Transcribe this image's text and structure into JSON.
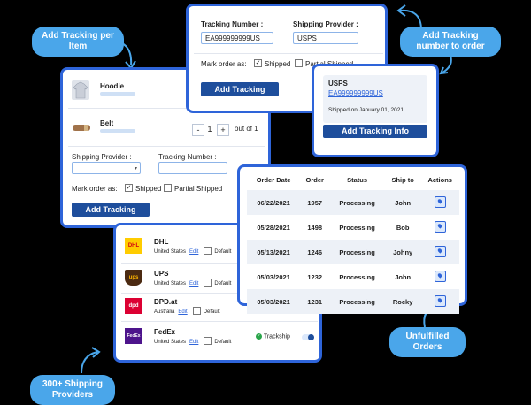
{
  "callouts": {
    "per_item": "Add Tracking per Item",
    "to_order": "Add Tracking number to order",
    "unfulfilled": "Unfulfilled Orders",
    "providers": "300+ Shipping Providers"
  },
  "top_panel": {
    "tracking_label": "Tracking Number :",
    "tracking_value": "EA999999999US",
    "provider_label": "Shipping Provider :",
    "provider_value": "USPS",
    "mark_label": "Mark order as:",
    "shipped_label": "Shipped",
    "partial_label": "Partial Shipped",
    "button": "Add Tracking"
  },
  "item_panel": {
    "items": [
      {
        "name": "Hoodie"
      },
      {
        "name": "Belt",
        "qty": "1",
        "qty_minus": "-",
        "qty_plus": "+",
        "out_of": "out of 1"
      }
    ],
    "provider_label": "Shipping Provider :",
    "tracking_label": "Tracking Number :",
    "mark_label": "Mark order as:",
    "shipped_label": "Shipped",
    "partial_label": "Partial Shipped",
    "button": "Add Tracking"
  },
  "info_panel": {
    "provider": "USPS",
    "tracking": "EA999999999US",
    "shipped_on": "Shipped on January 01, 2021",
    "button": "Add Tracking Info"
  },
  "orders_table": {
    "headers": [
      "Order Date",
      "Order",
      "Status",
      "Ship to",
      "Actions"
    ],
    "rows": [
      [
        "06/22/2021",
        "1957",
        "Processing",
        "John"
      ],
      [
        "05/28/2021",
        "1498",
        "Processing",
        "Bob"
      ],
      [
        "05/13/2021",
        "1246",
        "Processing",
        "Johny"
      ],
      [
        "05/03/2021",
        "1232",
        "Processing",
        "John"
      ],
      [
        "05/03/2021",
        "1231",
        "Processing",
        "Rocky"
      ]
    ]
  },
  "providers_panel": {
    "providers": [
      {
        "name": "DHL",
        "country": "United States",
        "edit": "Edit",
        "default": "Default",
        "logo": "DHL",
        "color": "#ffcc00",
        "text_color": "#d40511"
      },
      {
        "name": "UPS",
        "country": "United States",
        "edit": "Edit",
        "default": "Default",
        "logo": "ups",
        "color": "#4b2a12",
        "text_color": "#ffb500"
      },
      {
        "name": "DPD.at",
        "country": "Australia",
        "edit": "Edit",
        "default": "Default",
        "logo": "dpd",
        "color": "#dc0032",
        "text_color": "#ffffff"
      },
      {
        "name": "FedEx",
        "country": "United States",
        "edit": "Edit",
        "default": "Default",
        "logo": "FedEx",
        "color": "#4d148c",
        "text_color": "#ffffff"
      }
    ],
    "trackship_label": "Trackship"
  },
  "colors": {
    "accent": "#2e64d9",
    "button": "#1e4e9c",
    "callout": "#4aa6ea"
  }
}
